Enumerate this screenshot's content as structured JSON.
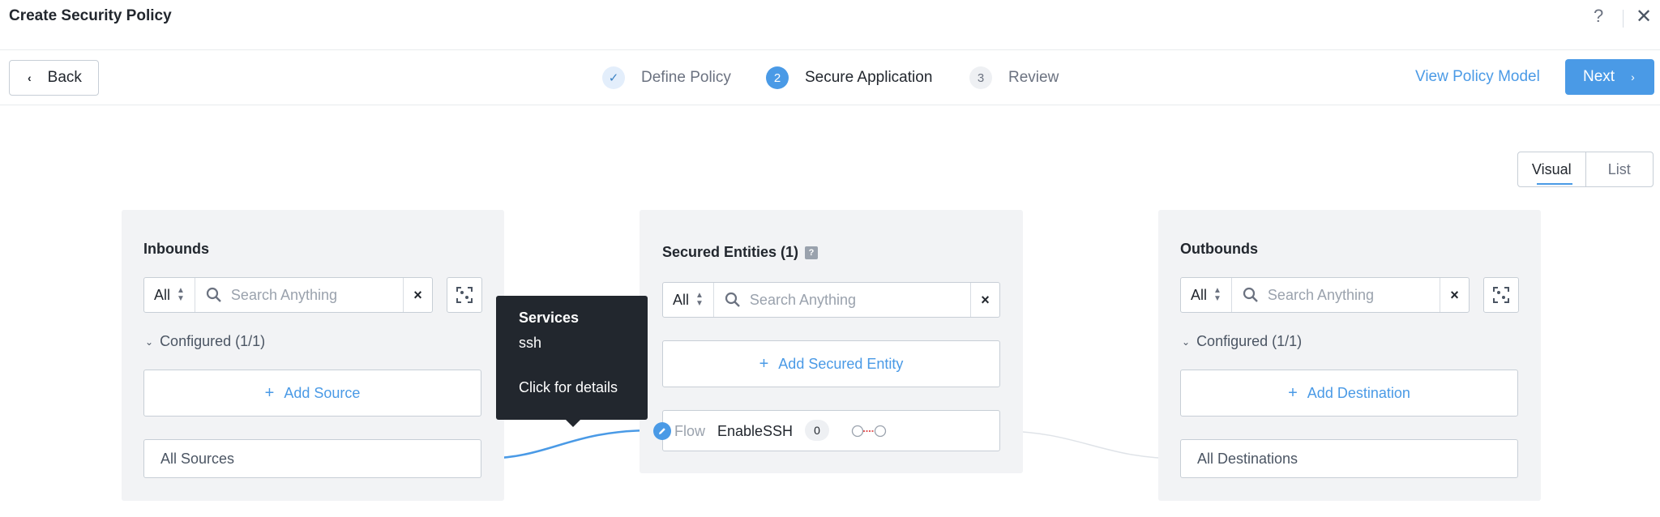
{
  "header": {
    "title": "Create Security Policy",
    "help_icon": "?",
    "close_icon": "✕"
  },
  "toolbar": {
    "back_label": "Back",
    "steps": [
      {
        "number": "✓",
        "label": "Define Policy",
        "state": "done"
      },
      {
        "number": "2",
        "label": "Secure Application",
        "state": "active"
      },
      {
        "number": "3",
        "label": "Review",
        "state": "todo"
      }
    ],
    "view_model_label": "View Policy Model",
    "next_label": "Next"
  },
  "view_toggle": {
    "options": [
      "Visual",
      "List"
    ],
    "selected": "Visual"
  },
  "inbounds": {
    "title": "Inbounds",
    "filter_value": "All",
    "search_placeholder": "Search Anything",
    "configured_label": "Configured (1/1)",
    "add_label": "Add Source",
    "entity": "All Sources"
  },
  "secured": {
    "title": "Secured Entities (1)",
    "help_badge": "?",
    "filter_value": "All",
    "search_placeholder": "Search Anything",
    "add_label": "Add Secured Entity",
    "flow": {
      "prefix": "Flow",
      "name": "EnableSSH",
      "count": "0"
    }
  },
  "outbounds": {
    "title": "Outbounds",
    "filter_value": "All",
    "search_placeholder": "Search Anything",
    "configured_label": "Configured (1/1)",
    "add_label": "Add Destination",
    "entity": "All Destinations"
  },
  "tooltip": {
    "heading": "Services",
    "value": "ssh",
    "link": "Click for details"
  },
  "colors": {
    "accent": "#4a9ae6",
    "panel_bg": "#f2f3f5",
    "tooltip_bg": "#22272e",
    "flow_toggle_red": "#e25c5c"
  },
  "icons": [
    "help-icon",
    "close-icon",
    "chevron-left-icon",
    "chevron-right-icon",
    "check-icon",
    "search-icon",
    "clear-icon",
    "focus-icon",
    "chevron-down-icon",
    "plus-icon",
    "pencil-icon",
    "flow-toggle-icon"
  ]
}
